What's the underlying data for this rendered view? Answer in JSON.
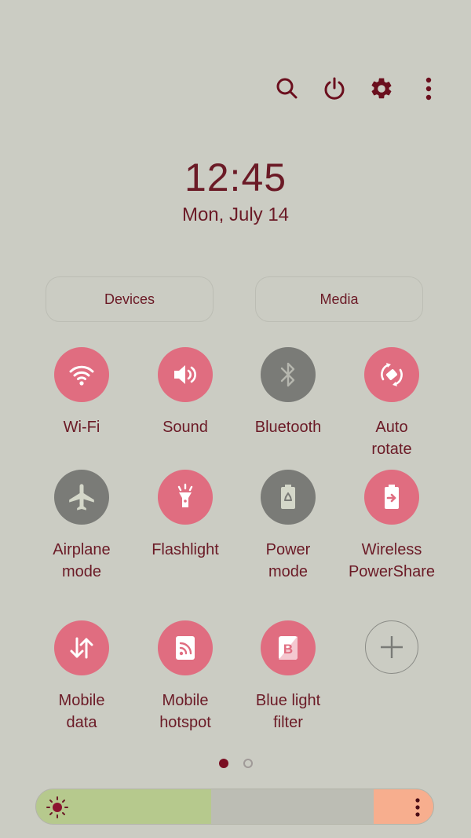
{
  "header": {
    "icons": [
      "search-icon",
      "power-icon",
      "settings-icon",
      "more-options-icon"
    ]
  },
  "clock": {
    "time": "12:45",
    "date": "Mon, July 14"
  },
  "pills": {
    "devices": "Devices",
    "media": "Media"
  },
  "tiles": [
    {
      "label": "Wi-Fi",
      "icon": "wifi-icon",
      "state": "on"
    },
    {
      "label": "Sound",
      "icon": "sound-icon",
      "state": "on"
    },
    {
      "label": "Bluetooth",
      "icon": "bluetooth-icon",
      "state": "off"
    },
    {
      "label": "Auto\nrotate",
      "icon": "auto-rotate-icon",
      "state": "on"
    },
    {
      "label": "Airplane\nmode",
      "icon": "airplane-icon",
      "state": "off"
    },
    {
      "label": "Flashlight",
      "icon": "flashlight-icon",
      "state": "on"
    },
    {
      "label": "Power\nmode",
      "icon": "power-mode-icon",
      "state": "off"
    },
    {
      "label": "Wireless\nPowerShare",
      "icon": "wireless-powershare-icon",
      "state": "on"
    },
    {
      "label": "Mobile\ndata",
      "icon": "mobile-data-icon",
      "state": "on"
    },
    {
      "label": "Mobile\nhotspot",
      "icon": "mobile-hotspot-icon",
      "state": "on"
    },
    {
      "label": "Blue light\nfilter",
      "icon": "blue-light-filter-icon",
      "state": "on"
    },
    {
      "label": "",
      "icon": "add-icon",
      "state": "add"
    }
  ],
  "pagination": {
    "current_page": 1,
    "total_pages": 2
  },
  "brightness": {
    "level_percent": 44
  },
  "colors": {
    "background": "#cbccc3",
    "accent_text": "#6b1a26",
    "tile_on": "#e06d80",
    "tile_off": "#7a7b77",
    "brightness_fill": "#b6c98d",
    "brightness_track": "#bcbdb4",
    "brightness_end": "#f7ae8e"
  }
}
